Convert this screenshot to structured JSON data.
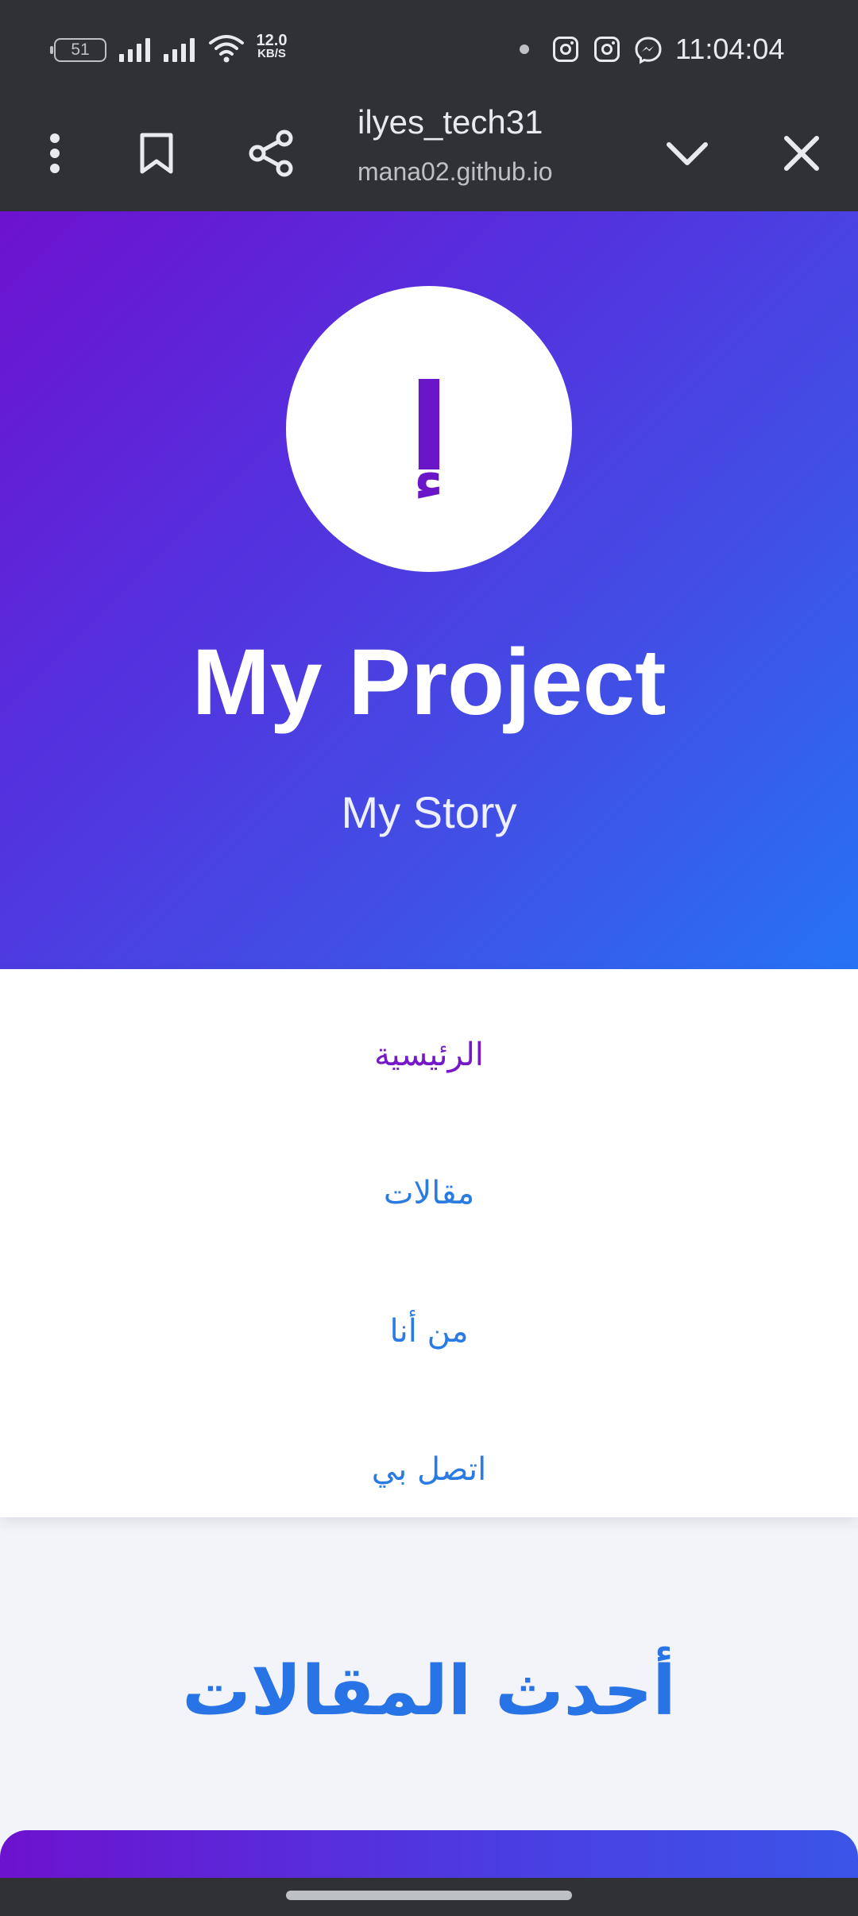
{
  "status_bar": {
    "battery_level": "51",
    "net_speed_value": "12.0",
    "net_speed_unit": "KB/S",
    "time": "11:04:04",
    "icons": [
      "signal-icon",
      "signal-icon",
      "wifi-icon",
      "dot-icon",
      "instagram-icon",
      "instagram-icon",
      "messenger-icon"
    ]
  },
  "browser": {
    "page_title": "ilyes_tech31",
    "domain": "mana02.github.io",
    "icons": [
      "more-vert-icon",
      "bookmark-icon",
      "share-icon",
      "chevron-down-icon",
      "close-icon"
    ]
  },
  "hero": {
    "avatar_letter": "إ",
    "title": "My Project",
    "subtitle": "My Story",
    "gradient_colors": [
      "#6d12cf",
      "#2673f4"
    ]
  },
  "nav": {
    "items": [
      {
        "label": "الرئيسية",
        "active": true
      },
      {
        "label": "مقالات",
        "active": false
      },
      {
        "label": "من أنا",
        "active": false
      },
      {
        "label": "اتصل بي",
        "active": false
      }
    ],
    "active_color": "#7418c8",
    "link_color": "#2a7be4"
  },
  "latest": {
    "title": "أحدث المقالات"
  }
}
